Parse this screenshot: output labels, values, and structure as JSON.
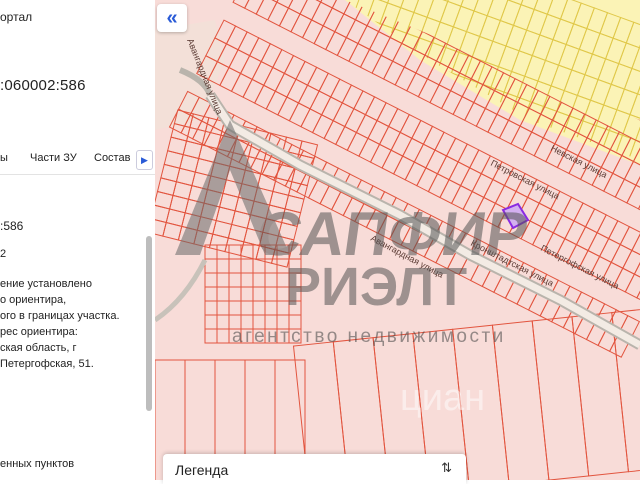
{
  "panel": {
    "title": "ортал",
    "cadastral_number": ":060002:586",
    "tabs": [
      {
        "label": "ы"
      },
      {
        "label": "Части ЗУ"
      },
      {
        "label": "Состав"
      }
    ],
    "next_tab_icon": "chevron-right-icon",
    "info_lines": [
      ":586",
      "2",
      "ение установлено",
      "о ориентира,",
      "ого в границах участка.",
      "рес ориентира:",
      "ская область, г",
      "Петергофская, 51."
    ],
    "bottom_line": "енных пунктов"
  },
  "map": {
    "collapse_icon": "double-chevron-left-icon",
    "streets": [
      "Авангардная улица",
      "Петровская улица",
      "Кронштадтская улица",
      "Петергофская улица",
      "Невская улица",
      "Авангардная улица"
    ],
    "watermark": {
      "brand_line1": "САПФИР",
      "brand_line2": "РИЭЛТ",
      "tagline": "агентство недвижимости",
      "cian": "циан"
    },
    "colors": {
      "parcel_fill": "#f8dcd8",
      "parcel_stroke": "#e2553f",
      "zone_yellow": "#fbf3b6",
      "zone_yellow_stroke": "#e0c84a",
      "selected_parcel": "#8a2be2",
      "road": "#b9b4ac"
    }
  },
  "legend": {
    "label": "Легенда",
    "toggle_icon": "chevron-updown-icon"
  }
}
